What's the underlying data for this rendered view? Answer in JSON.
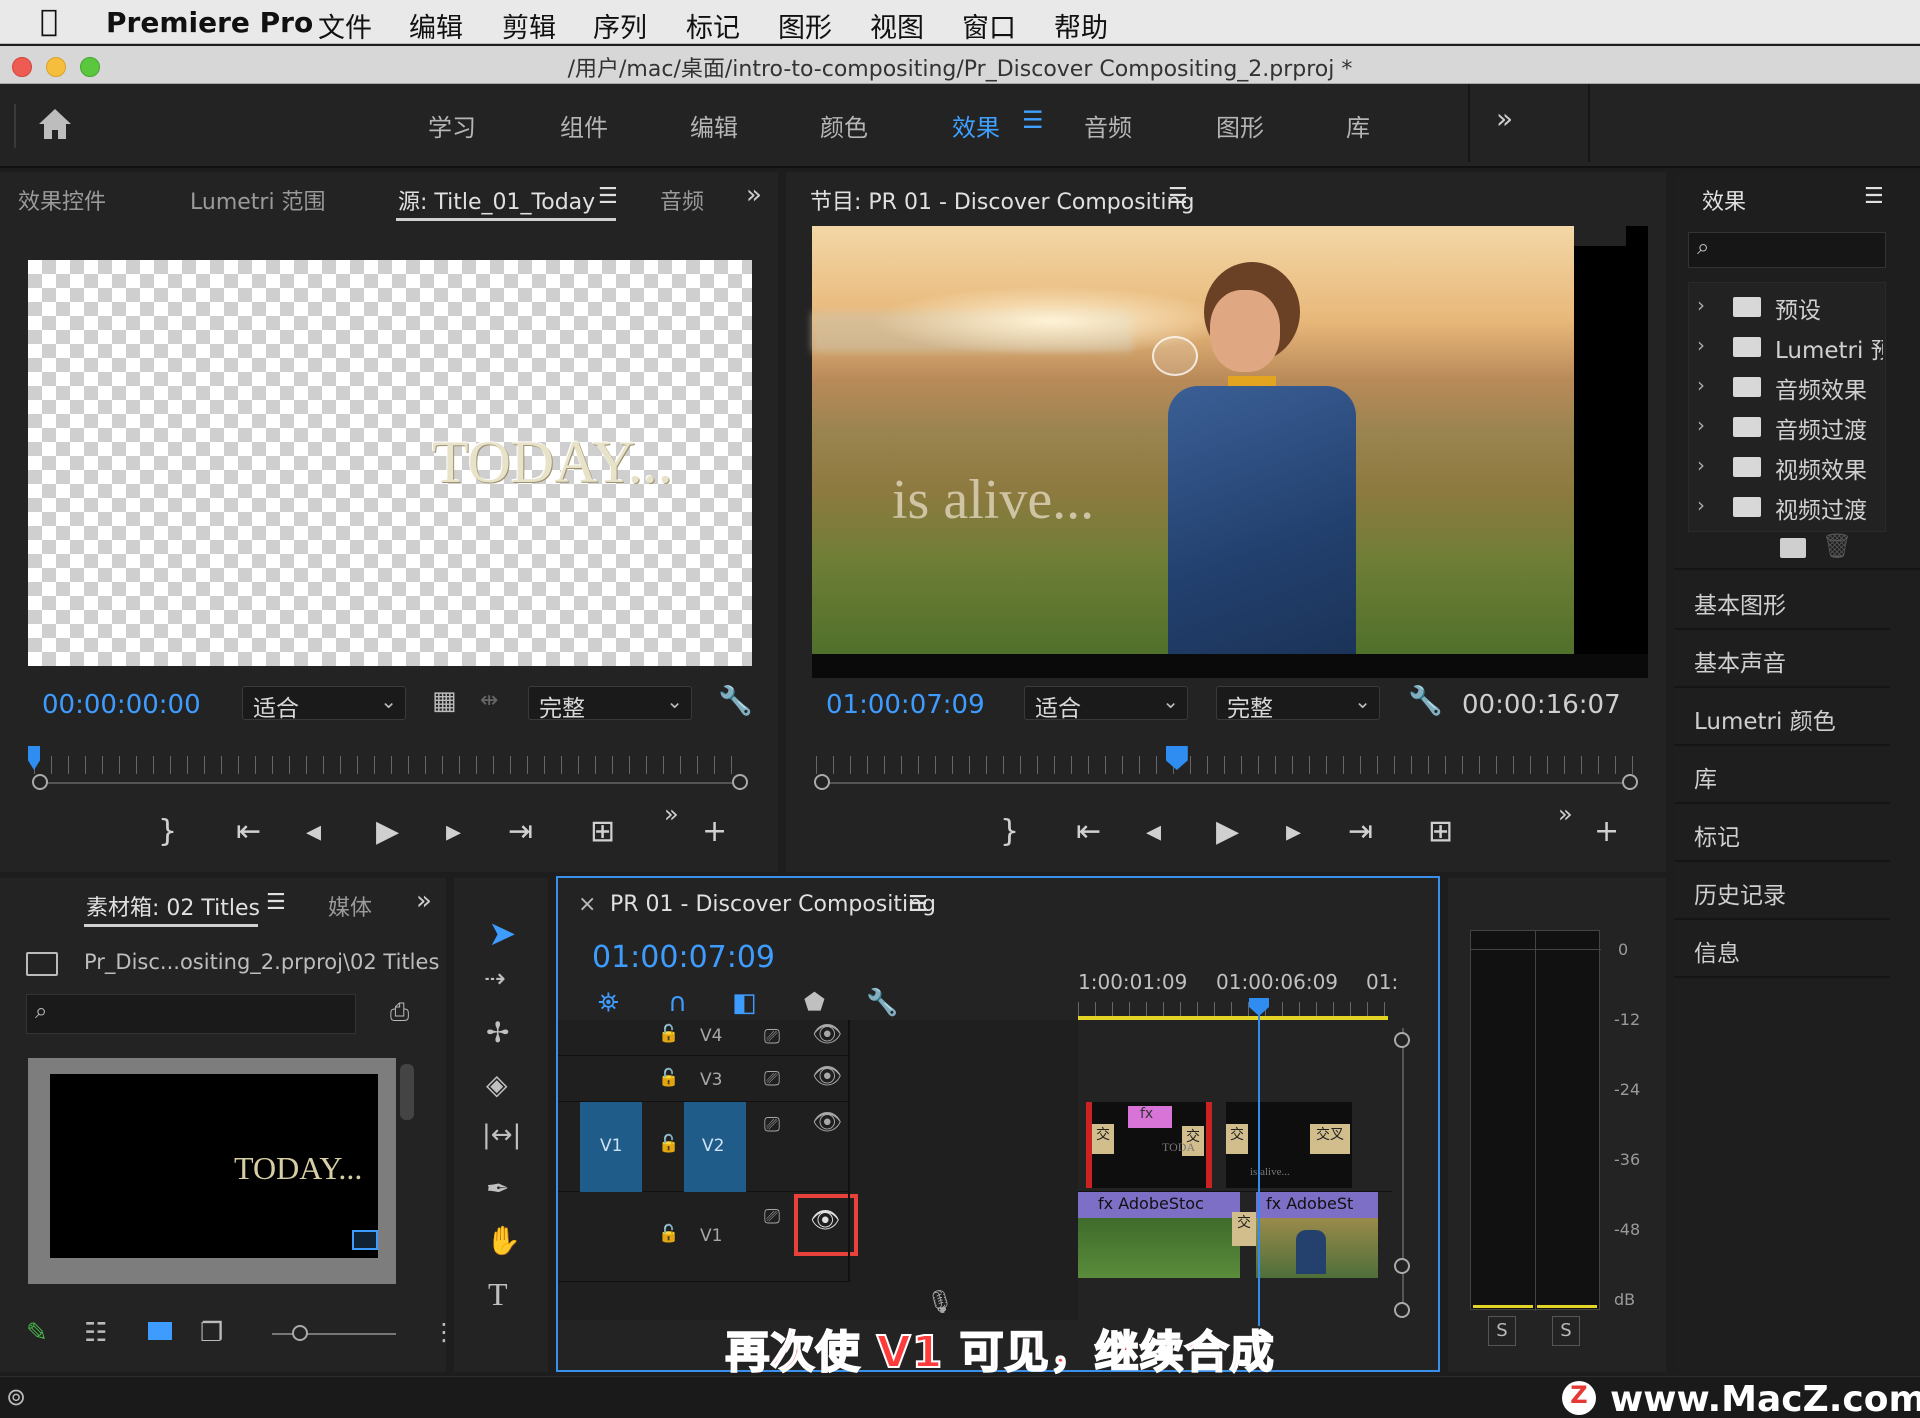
{
  "menubar": {
    "app_name": "Premiere Pro",
    "items": [
      "文件",
      "编辑",
      "剪辑",
      "序列",
      "标记",
      "图形",
      "视图",
      "窗口",
      "帮助"
    ]
  },
  "window": {
    "title": "/用户/mac/桌面/intro-to-compositing/Pr_Discover Compositing_2.prproj *"
  },
  "workspaces": {
    "items": [
      "学习",
      "组件",
      "编辑",
      "颜色",
      "效果",
      "音频",
      "图形",
      "库"
    ],
    "active": "效果",
    "more": "»"
  },
  "source_panel": {
    "tabs": [
      "效果控件",
      "Lumetri 范围",
      "源: Title_01_Today",
      "音频"
    ],
    "more": "»",
    "preview_text": "TODAY...",
    "timecode": "00:00:00:00",
    "zoom": "适合",
    "quality": "完整"
  },
  "program_panel": {
    "title": "节目: PR 01 - Discover Compositing",
    "overlay_text": "is alive...",
    "timecode": "01:00:07:09",
    "zoom": "适合",
    "quality": "完整",
    "duration": "00:00:16:07",
    "playhead_fraction": 0.44
  },
  "effects_panel": {
    "title": "效果",
    "search_placeholder": "",
    "items": [
      "预设",
      "Lumetri 预设",
      "音频效果",
      "音频过渡",
      "视频效果",
      "视频过渡"
    ],
    "side_panels": [
      "基本图形",
      "基本声音",
      "Lumetri 颜色",
      "库",
      "标记",
      "历史记录",
      "信息"
    ]
  },
  "project_panel": {
    "tabs": [
      "素材箱: 02 Titles",
      "媒体"
    ],
    "more": "»",
    "path": "Pr_Disc...ositing_2.prproj\\02 Titles",
    "search_placeholder": "",
    "thumb_text": "TODAY..."
  },
  "timeline": {
    "title": "PR 01 - Discover Compositing",
    "timecode": "01:00:07:09",
    "ruler_labels": [
      "1:00:01:09",
      "01:00:06:09",
      "01:"
    ],
    "tracks": [
      {
        "name": "V4"
      },
      {
        "name": "V3"
      },
      {
        "name": "V2",
        "source": "V1"
      },
      {
        "name": "V1"
      }
    ],
    "clips": {
      "v1_a": "AdobeStoc",
      "v1_b": "AdobeSt",
      "transition": "交",
      "transition2": "交叉",
      "v2_title_a": "TODA",
      "v2_title_b": "is alive...",
      "fx_badge": "fx"
    },
    "caption": "再次使 V1 可见，继续合成"
  },
  "audio_meter": {
    "ticks": [
      "0",
      "-12",
      "-24",
      "-36",
      "-48",
      "dB"
    ],
    "solo": [
      "S",
      "S"
    ]
  },
  "watermark": {
    "logo_letter": "Z",
    "text": "www.MacZ.com"
  },
  "colors": {
    "accent": "#3f9cff",
    "highlight_box": "#e8413b",
    "track_source": "#1f5c8a",
    "caption_fill": "#ff3b3b"
  }
}
